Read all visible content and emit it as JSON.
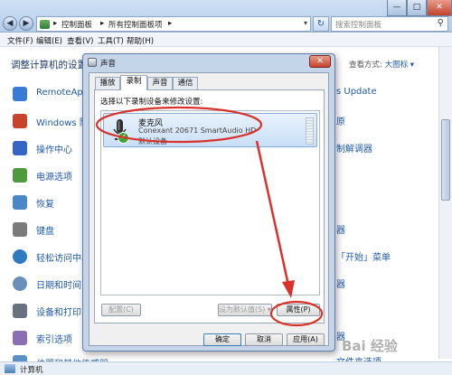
{
  "window": {
    "min_glyph": "—",
    "max_glyph": "□",
    "close_glyph": "✕",
    "back_glyph": "◀",
    "forward_glyph": "▶"
  },
  "address": {
    "crumbs": [
      "控制面板",
      "所有控制面板项"
    ],
    "sep": "▸",
    "refresh_glyph": "↻"
  },
  "search": {
    "placeholder": "搜索控制面板",
    "glyph": "⚲"
  },
  "menu": [
    "文件(F)",
    "编辑(E)",
    "查看(V)",
    "工具(T)",
    "帮助(H)"
  ],
  "cp": {
    "heading": "调整计算机的设置",
    "view_label": "查看方式:",
    "view_value": "大图标 ▾",
    "items": [
      {
        "label": "RemoteApp",
        "color": "#3a7bd5"
      },
      {
        "label": "Windows 防",
        "color": "#c6442b"
      },
      {
        "label": "操作中心",
        "color": "#3566c2"
      },
      {
        "label": "电源选项",
        "color": "#4f9a3c"
      },
      {
        "label": "恢复",
        "color": "#4a86c8"
      },
      {
        "label": "键盘",
        "color": "#7b7b7b"
      },
      {
        "label": "轻松访问中心",
        "color": "#2e7bc0"
      },
      {
        "label": "日期和时间",
        "color": "#6b8fb8"
      },
      {
        "label": "设备和打印",
        "color": "#6a7280"
      },
      {
        "label": "索引选项",
        "color": "#8a6fb3"
      },
      {
        "label": "位置和其他传感器",
        "color": "#5a8fc8"
      }
    ],
    "right_items": [
      "s Update",
      "原",
      "制解调器",
      "器",
      "「开始」菜单",
      "器",
      "器",
      "文件夹选项"
    ]
  },
  "status": {
    "text": "计算机"
  },
  "dialog": {
    "title": "声音",
    "close_glyph": "✕",
    "tabs": [
      "播放",
      "录制",
      "声音",
      "通信"
    ],
    "instruction": "选择以下录制设备来修改设置:",
    "device": {
      "name": "麦克风",
      "description": "Conexant 20671 SmartAudio HD",
      "state": "默认设备",
      "check_glyph": "✓"
    },
    "configure": "配置(C)",
    "set_default": "设为默认值(S) ▾",
    "properties": "属性(P)",
    "ok": "确定",
    "cancel": "取消",
    "apply": "应用(A)"
  },
  "watermark": "Bai 经验"
}
